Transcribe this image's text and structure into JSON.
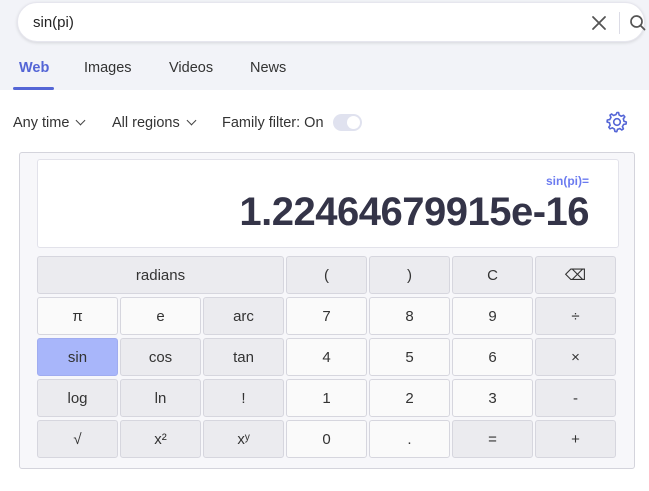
{
  "search": {
    "query": "sin(pi)"
  },
  "tabs": [
    {
      "label": "Web",
      "active": true
    },
    {
      "label": "Images",
      "active": false
    },
    {
      "label": "Videos",
      "active": false
    },
    {
      "label": "News",
      "active": false
    }
  ],
  "filters": {
    "time": "Any time",
    "region": "All regions",
    "family": "Family filter: On"
  },
  "calculator": {
    "expression": "sin(pi)=",
    "result": "1.22464679915e-16",
    "buttons": {
      "radians": "radians",
      "lparen": "(",
      "rparen": ")",
      "clear": "C",
      "backspace": "⌫",
      "pi": "π",
      "e": "e",
      "arc": "arc",
      "seven": "7",
      "eight": "8",
      "nine": "9",
      "divide": "÷",
      "sin": "sin",
      "cos": "cos",
      "tan": "tan",
      "four": "4",
      "five": "5",
      "six": "6",
      "multiply": "×",
      "log": "log",
      "ln": "ln",
      "factorial": "!",
      "one": "1",
      "two": "2",
      "three": "3",
      "minus": "-",
      "sqrt": "√",
      "square": "x²",
      "power": "xʸ",
      "zero": "0",
      "dot": ".",
      "equals": "=",
      "plus": "+"
    }
  }
}
